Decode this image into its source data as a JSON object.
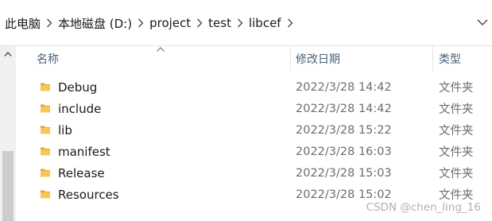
{
  "breadcrumb": {
    "items": [
      "此电脑",
      "本地磁盘 (D:)",
      "project",
      "test",
      "libcef"
    ],
    "dropdown_icon": "chevron-down-icon"
  },
  "columns": {
    "name": "名称",
    "date": "修改日期",
    "type": "类型"
  },
  "sort": {
    "column": "name",
    "direction": "ascending"
  },
  "rows": [
    {
      "name": "Debug",
      "date": "2022/3/28 14:42",
      "type": "文件夹"
    },
    {
      "name": "include",
      "date": "2022/3/28 14:42",
      "type": "文件夹"
    },
    {
      "name": "lib",
      "date": "2022/3/28 15:22",
      "type": "文件夹"
    },
    {
      "name": "manifest",
      "date": "2022/3/28 16:03",
      "type": "文件夹"
    },
    {
      "name": "Release",
      "date": "2022/3/28 15:03",
      "type": "文件夹"
    },
    {
      "name": "Resources",
      "date": "2022/3/28 15:02",
      "type": "文件夹"
    }
  ],
  "watermark": "CSDN @chen_ling_16",
  "colors": {
    "folder": "#f7c75a",
    "folder_dark": "#e3a52b",
    "header_text": "#4c607a",
    "secondary_text": "#6d6d6d"
  },
  "icons": {
    "folder": "folder-icon",
    "separator": "chevron-right-icon",
    "sort": "sort-ascending-icon",
    "scroll_up": "scroll-up-arrow-icon"
  }
}
